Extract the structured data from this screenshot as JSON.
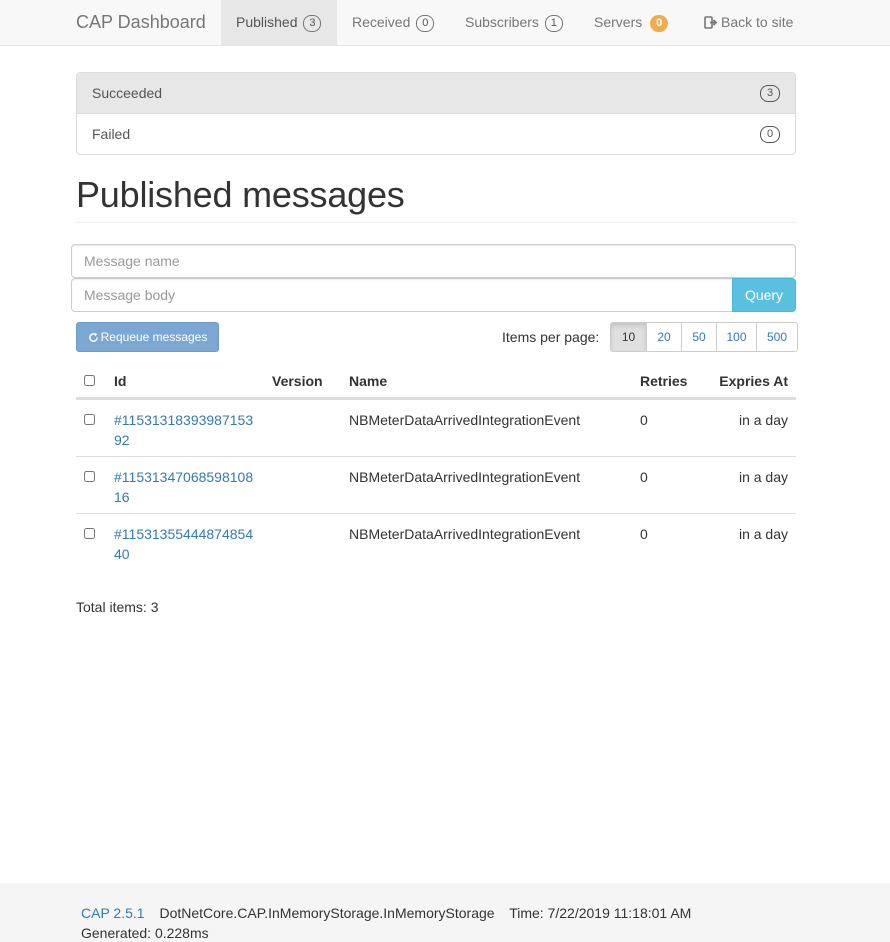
{
  "navbar": {
    "brand": "CAP Dashboard",
    "items": [
      {
        "label": "Published",
        "badge": "3"
      },
      {
        "label": "Received",
        "badge": "0"
      },
      {
        "label": "Subscribers",
        "badge": "1"
      },
      {
        "label": "Servers",
        "badge": "0"
      }
    ],
    "back_label": "Back to site"
  },
  "status": [
    {
      "label": "Succeeded",
      "count": "3"
    },
    {
      "label": "Failed",
      "count": "0"
    }
  ],
  "page_title": "Published messages",
  "filters": {
    "name_placeholder": "Message name",
    "body_placeholder": "Message body",
    "query_label": "Query"
  },
  "toolbar": {
    "requeue_label": "Requeue messages",
    "items_per_page_label": "Items per page:",
    "page_sizes": [
      "10",
      "20",
      "50",
      "100",
      "500"
    ],
    "selected_page_size": "10"
  },
  "table": {
    "headers": [
      "Id",
      "Version",
      "Name",
      "Retries",
      "Expries At"
    ],
    "rows": [
      {
        "id": "#1153131839398715392",
        "version": "",
        "name": "NBMeterDataArrivedIntegrationEvent",
        "retries": "0",
        "expires": "in a day"
      },
      {
        "id": "#1153134706859810816",
        "version": "",
        "name": "NBMeterDataArrivedIntegrationEvent",
        "retries": "0",
        "expires": "in a day"
      },
      {
        "id": "#1153135544487485440",
        "version": "",
        "name": "NBMeterDataArrivedIntegrationEvent",
        "retries": "0",
        "expires": "in a day"
      }
    ],
    "total": "Total items: 3"
  },
  "footer": {
    "version": "CAP 2.5.1",
    "storage": "DotNetCore.CAP.InMemoryStorage.InMemoryStorage",
    "time": "Time: 7/22/2019 11:18:01 AM",
    "generated": "Generated: 0.228ms"
  },
  "colors": {
    "link": "#337ab7",
    "query_button": "#5bc0de",
    "requeue_button": "#7da7d3",
    "servers_badge": "#f0ad4e"
  }
}
